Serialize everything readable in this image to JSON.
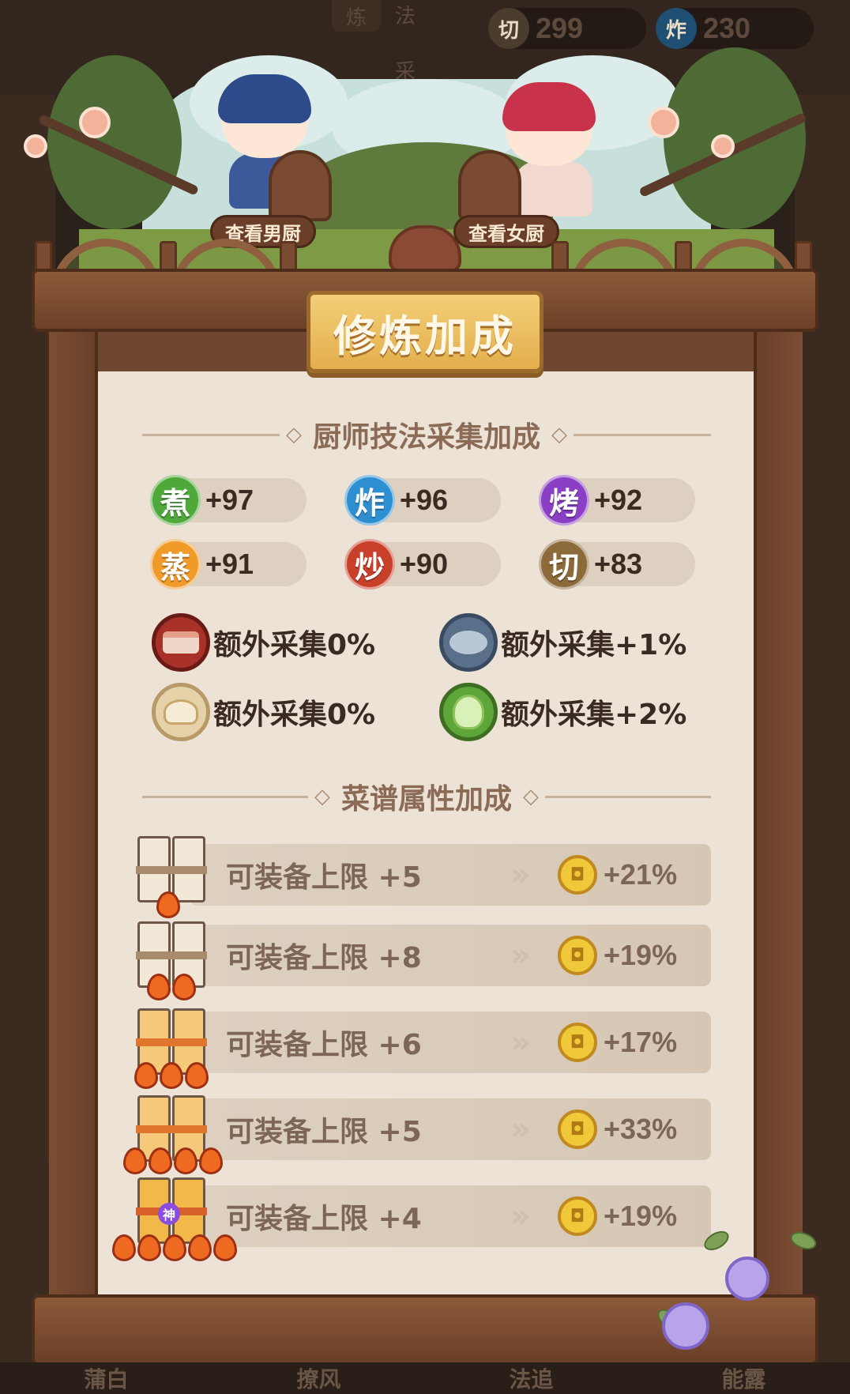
{
  "hud": {
    "tab_a": "炼",
    "tab_b": "法",
    "tab_c": "采",
    "resources": [
      {
        "icon": "切",
        "value": "299",
        "color": "#6b5a3a"
      },
      {
        "icon": "炸",
        "value": "230",
        "color": "#2e7fb8"
      }
    ]
  },
  "scene": {
    "view_male_chef": "查看男厨",
    "view_female_chef": "查看女厨"
  },
  "panel": {
    "title": "修炼加成",
    "section_skills": "厨师技法采集加成",
    "section_recipes": "菜谱属性加成"
  },
  "techniques": [
    {
      "icon_char": "煮",
      "value": "+97",
      "color": "#4fa83a"
    },
    {
      "icon_char": "炸",
      "value": "+96",
      "color": "#2e8fd0"
    },
    {
      "icon_char": "烤",
      "value": "+92",
      "color": "#8a3fc4"
    },
    {
      "icon_char": "蒸",
      "value": "+91",
      "color": "#f09a2a"
    },
    {
      "icon_char": "炒",
      "value": "+90",
      "color": "#c8402a"
    },
    {
      "icon_char": "切",
      "value": "+83",
      "color": "#8c6a3a"
    }
  ],
  "extra_gather": [
    {
      "icon": "meat-icon",
      "text": "额外采集0%"
    },
    {
      "icon": "fish-icon",
      "text": "额外采集+1%"
    },
    {
      "icon": "flour-icon",
      "text": "额外采集0%"
    },
    {
      "icon": "cabbage-icon",
      "text": "额外采集+2%"
    }
  ],
  "recipe_rows": [
    {
      "label": "可装备上限 +5",
      "value": "+21%",
      "flames": 1
    },
    {
      "label": "可装备上限 +8",
      "value": "+19%",
      "flames": 2
    },
    {
      "label": "可装备上限 +6",
      "value": "+17%",
      "flames": 3
    },
    {
      "label": "可装备上限 +5",
      "value": "+33%",
      "flames": 4
    },
    {
      "label": "可装备上限 +4",
      "value": "+19%",
      "flames": 5,
      "badge": "神"
    }
  ],
  "bottom_tabs": [
    "蒲白",
    "撩风",
    "法追",
    "能露"
  ]
}
